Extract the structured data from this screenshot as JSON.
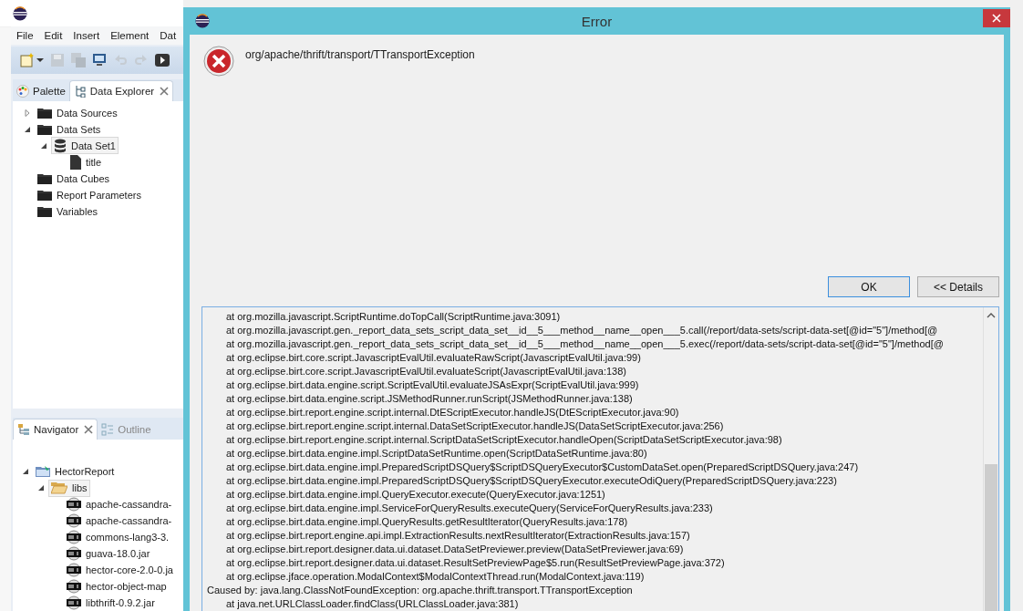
{
  "ide": {
    "menu": [
      "File",
      "Edit",
      "Insert",
      "Element",
      "Dat"
    ],
    "top_tabs": [
      {
        "label": "Palette",
        "kind": "palette",
        "selected": false
      },
      {
        "label": "Data Explorer",
        "kind": "explorer",
        "selected": true
      }
    ],
    "data_tree": [
      {
        "label": "Data Sources",
        "kind": "folder",
        "expanded": false,
        "selected": false
      },
      {
        "label": "Data Sets",
        "kind": "folder",
        "expanded": true,
        "selected": false,
        "children": [
          {
            "label": "Data Set1",
            "kind": "dataset",
            "expanded": true,
            "selected": true,
            "children": [
              {
                "label": "title",
                "kind": "column",
                "selected": false
              }
            ]
          }
        ]
      },
      {
        "label": "Data Cubes",
        "kind": "folder",
        "selected": false
      },
      {
        "label": "Report Parameters",
        "kind": "folder",
        "selected": false
      },
      {
        "label": "Variables",
        "kind": "folder",
        "selected": false
      }
    ],
    "bottom_tabs": [
      {
        "label": "Navigator",
        "kind": "navigator",
        "selected": true
      },
      {
        "label": "Outline",
        "kind": "outline",
        "selected": false
      }
    ],
    "nav_tree": [
      {
        "label": "HectorReport",
        "kind": "project",
        "expanded": true,
        "selected": false,
        "children": [
          {
            "label": "libs",
            "kind": "openfolder",
            "expanded": true,
            "selected": true,
            "children": [
              {
                "label": "apache-cassandra-",
                "kind": "jar",
                "selected": false
              },
              {
                "label": "apache-cassandra-",
                "kind": "jar",
                "selected": false
              },
              {
                "label": "commons-lang3-3.",
                "kind": "jar",
                "selected": false
              },
              {
                "label": "guava-18.0.jar",
                "kind": "jar",
                "selected": false
              },
              {
                "label": "hector-core-2.0-0.ja",
                "kind": "jar",
                "selected": false
              },
              {
                "label": "hector-object-map",
                "kind": "jar",
                "selected": false
              },
              {
                "label": "libthrift-0.9.2.jar",
                "kind": "jar",
                "selected": false
              }
            ]
          }
        ]
      }
    ]
  },
  "dialog": {
    "title": "Error",
    "message": "org/apache/thrift/transport/TTransportException",
    "buttons": [
      {
        "label": "OK",
        "default": true
      },
      {
        "label": "<< Details",
        "default": false
      }
    ],
    "details": [
      {
        "kind": "frame",
        "text": "at org.mozilla.javascript.ScriptRuntime.doTopCall(ScriptRuntime.java:3091)"
      },
      {
        "kind": "frame",
        "text": "at org.mozilla.javascript.gen._report_data_sets_script_data_set__id__5___method__name__open___5.call(/report/data-sets/script-data-set[@id=\"5\"]/method[@"
      },
      {
        "kind": "frame",
        "text": "at org.mozilla.javascript.gen._report_data_sets_script_data_set__id__5___method__name__open___5.exec(/report/data-sets/script-data-set[@id=\"5\"]/method[@"
      },
      {
        "kind": "frame",
        "text": "at org.eclipse.birt.core.script.JavascriptEvalUtil.evaluateRawScript(JavascriptEvalUtil.java:99)"
      },
      {
        "kind": "frame",
        "text": "at org.eclipse.birt.core.script.JavascriptEvalUtil.evaluateScript(JavascriptEvalUtil.java:138)"
      },
      {
        "kind": "frame",
        "text": "at org.eclipse.birt.data.engine.script.ScriptEvalUtil.evaluateJSAsExpr(ScriptEvalUtil.java:999)"
      },
      {
        "kind": "frame",
        "text": "at org.eclipse.birt.data.engine.script.JSMethodRunner.runScript(JSMethodRunner.java:138)"
      },
      {
        "kind": "frame",
        "text": "at org.eclipse.birt.report.engine.script.internal.DtEScriptExecutor.handleJS(DtEScriptExecutor.java:90)"
      },
      {
        "kind": "frame",
        "text": "at org.eclipse.birt.report.engine.script.internal.DataSetScriptExecutor.handleJS(DataSetScriptExecutor.java:256)"
      },
      {
        "kind": "frame",
        "text": "at org.eclipse.birt.report.engine.script.internal.ScriptDataSetScriptExecutor.handleOpen(ScriptDataSetScriptExecutor.java:98)"
      },
      {
        "kind": "frame",
        "text": "at org.eclipse.birt.data.engine.impl.ScriptDataSetRuntime.open(ScriptDataSetRuntime.java:80)"
      },
      {
        "kind": "frame",
        "text": "at org.eclipse.birt.data.engine.impl.PreparedScriptDSQuery$ScriptDSQueryExecutor$CustomDataSet.open(PreparedScriptDSQuery.java:247)"
      },
      {
        "kind": "frame",
        "text": "at org.eclipse.birt.data.engine.impl.PreparedScriptDSQuery$ScriptDSQueryExecutor.executeOdiQuery(PreparedScriptDSQuery.java:223)"
      },
      {
        "kind": "frame",
        "text": "at org.eclipse.birt.data.engine.impl.QueryExecutor.execute(QueryExecutor.java:1251)"
      },
      {
        "kind": "frame",
        "text": "at org.eclipse.birt.data.engine.impl.ServiceForQueryResults.executeQuery(ServiceForQueryResults.java:233)"
      },
      {
        "kind": "frame",
        "text": "at org.eclipse.birt.data.engine.impl.QueryResults.getResultIterator(QueryResults.java:178)"
      },
      {
        "kind": "frame",
        "text": "at org.eclipse.birt.report.engine.api.impl.ExtractionResults.nextResultIterator(ExtractionResults.java:157)"
      },
      {
        "kind": "frame",
        "text": "at org.eclipse.birt.report.designer.data.ui.dataset.DataSetPreviewer.preview(DataSetPreviewer.java:69)"
      },
      {
        "kind": "frame",
        "text": "at org.eclipse.birt.report.designer.data.ui.dataset.ResultSetPreviewPage$5.run(ResultSetPreviewPage.java:372)"
      },
      {
        "kind": "frame",
        "text": "at org.eclipse.jface.operation.ModalContext$ModalContextThread.run(ModalContext.java:119)"
      },
      {
        "kind": "cause",
        "text": "Caused by: java.lang.ClassNotFoundException: org.apache.thrift.transport.TTransportException"
      },
      {
        "kind": "frame",
        "text": "at java.net.URLClassLoader.findClass(URLClassLoader.java:381)"
      }
    ]
  }
}
